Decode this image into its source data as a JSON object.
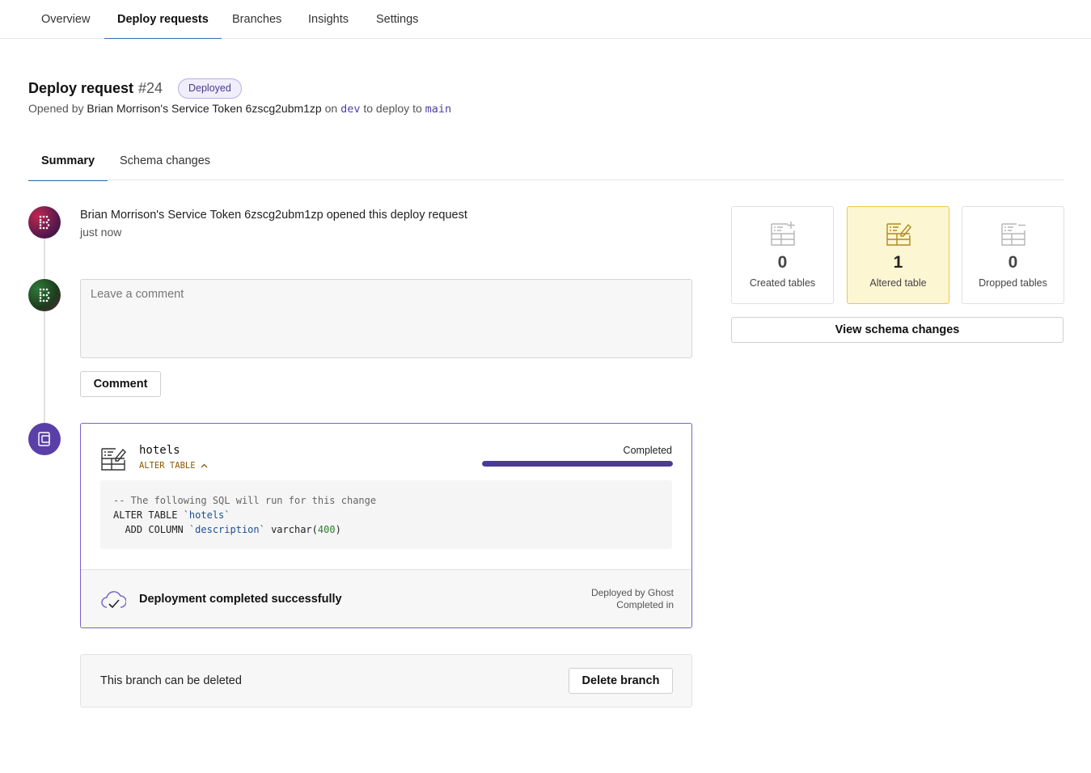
{
  "nav": {
    "tabs": [
      {
        "label": "Overview"
      },
      {
        "label": "Deploy requests"
      },
      {
        "label": "Branches"
      },
      {
        "label": "Insights"
      },
      {
        "label": "Settings"
      }
    ],
    "active_tab": "Deploy requests"
  },
  "deploy_request": {
    "title": "Deploy request",
    "number": "#24",
    "status_badge": "Deployed",
    "opened_prefix": "Opened by",
    "opened_by": "Brian Morrison's Service Token 6zscg2ubm1zp",
    "on_word": "on",
    "source_branch": "dev",
    "deploy_word": "to deploy to",
    "target_branch": "main"
  },
  "subtabs": {
    "tabs": [
      {
        "label": "Summary"
      },
      {
        "label": "Schema changes"
      }
    ],
    "active_tab": "Summary"
  },
  "timeline": {
    "event": {
      "actor": "Brian Morrison's Service Token 6zscg2ubm1zp",
      "action": "opened this deploy request",
      "time": "just now"
    },
    "comment": {
      "placeholder": "Leave a comment",
      "value": "",
      "button_label": "Comment"
    },
    "deploy": {
      "table_name": "hotels",
      "operation": "ALTER TABLE",
      "status": "Completed",
      "progress_fraction": 1.0,
      "sql_comment": "-- The following SQL will run for this change",
      "sql_line1_kw": "ALTER TABLE ",
      "sql_line1_ident": "`hotels`",
      "sql_line2_kw": "  ADD COLUMN ",
      "sql_line2_ident": "`description`",
      "sql_line2_type": " varchar(",
      "sql_line2_num": "400",
      "sql_line2_end": ")",
      "footer_message": "Deployment completed successfully",
      "deployed_by": "Deployed by Ghost",
      "completed_in": "Completed in"
    },
    "branch": {
      "message": "This branch can be deleted",
      "button_label": "Delete branch"
    }
  },
  "stats": {
    "created": {
      "count": "0",
      "label": "Created tables"
    },
    "altered": {
      "count": "1",
      "label": "Altered table"
    },
    "dropped": {
      "count": "0",
      "label": "Dropped tables"
    },
    "view_button_label": "View schema changes",
    "highlight_color": "#fdf6d3"
  },
  "colors": {
    "accent": "#4b3a96",
    "deploy_border": "#7b5fc9",
    "branch_code": "#4f3fa6"
  }
}
